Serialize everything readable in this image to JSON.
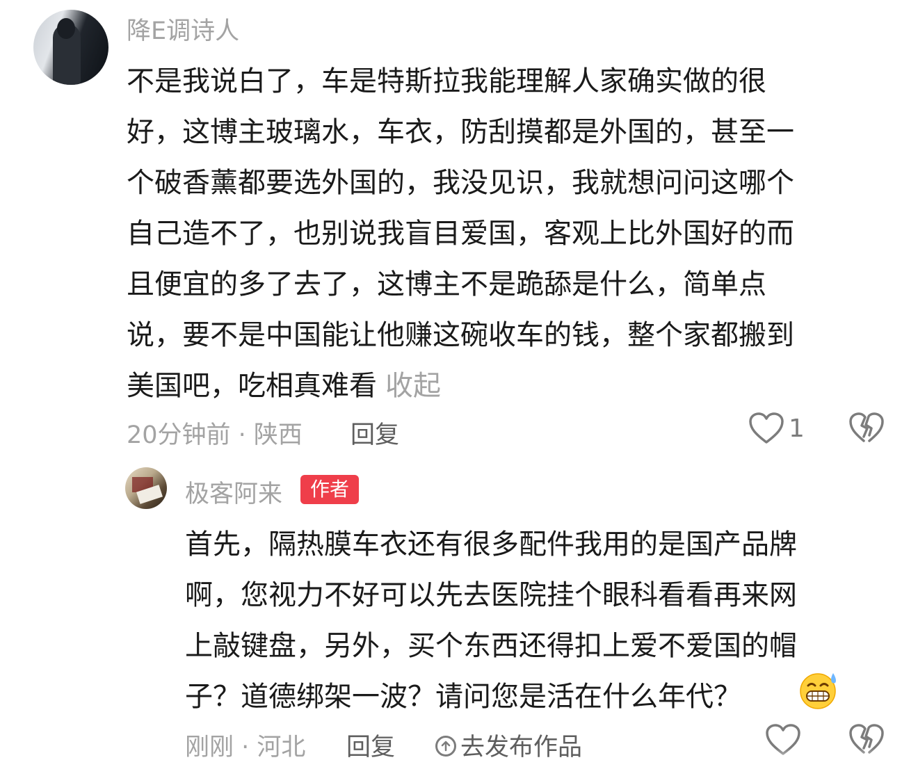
{
  "comment": {
    "username": "降E调诗人",
    "lines": [
      "不是我说白了，车是特斯拉我能理解人家确实做的很",
      "好，这博主玻璃水，车衣，防刮摸都是外国的，甚至一",
      "个破香薰都要选外国的，我没见识，我就想问问这哪个",
      "自己造不了，也别说我盲目爱国，客观上比外国好的而",
      "且便宜的多了去了，这博主不是跪舔是什么，简单点",
      "说，要不是中国能让他赚这碗收车的钱，整个家都搬到",
      "美国吧，吃相真难看"
    ],
    "collapse_label": "收起",
    "meta": "20分钟前 · 陕西",
    "reply_label": "回复",
    "like_count": "1",
    "icons": {
      "like": "heart-icon",
      "dislike": "broken-heart-icon"
    }
  },
  "reply": {
    "username": "极客阿来",
    "author_badge": "作者",
    "lines": [
      "首先，隔热膜车衣还有很多配件我用的是国产品牌",
      "啊，您视力不好可以先去医院挂个眼科看看再来网",
      "上敲键盘，另外，买个东西还得扣上爱不爱国的帽",
      "子？道德绑架一波？请问您是活在什么年代？"
    ],
    "emoji": "grinning-sweat-emoji",
    "meta": "刚刚 · 河北",
    "reply_label": "回复",
    "publish_label": "去发布作品",
    "icons": {
      "publish": "upload-circle-icon",
      "like": "heart-icon",
      "dislike": "broken-heart-icon"
    }
  },
  "colors": {
    "badge": "#ef3e4a",
    "muted": "#a3a3a3",
    "text": "#1a1a1a"
  }
}
